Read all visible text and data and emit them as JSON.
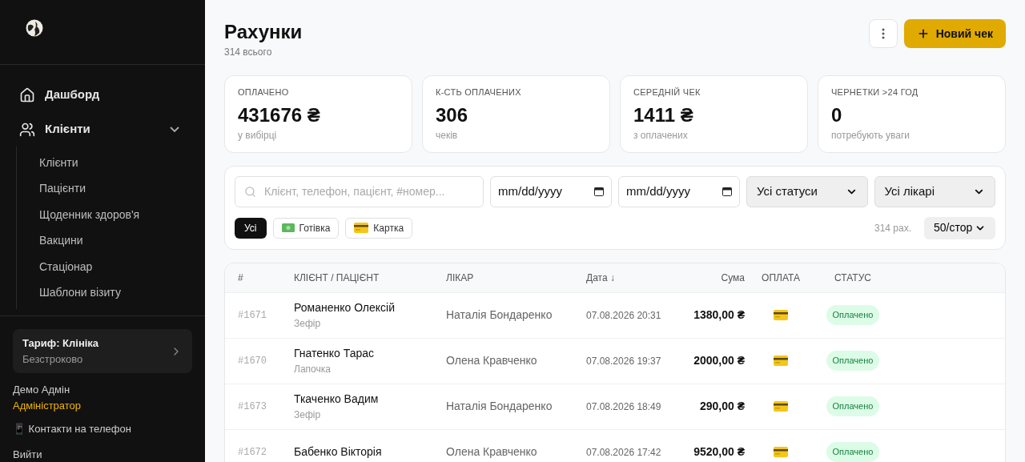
{
  "sidebar": {
    "nav": [
      {
        "label": "Дашборд"
      },
      {
        "label": "Клієнти",
        "expanded": true,
        "children": [
          {
            "label": "Клієнти"
          },
          {
            "label": "Пацієнти"
          },
          {
            "label": "Щоденник здоров'я"
          },
          {
            "label": "Вакцини"
          },
          {
            "label": "Стаціонар"
          },
          {
            "label": "Шаблони візиту"
          }
        ]
      }
    ],
    "plan": {
      "title": "Тариф: Клініка",
      "subtitle": "Безстроково"
    },
    "user": {
      "name": "Демо Адмін",
      "role": "Адміністратор"
    },
    "contacts": "📱 Контакти на телефон",
    "logout": "Вийти"
  },
  "header": {
    "title": "Рахунки",
    "subtitle": "314 всього",
    "new_button": "Новий чек"
  },
  "stats": [
    {
      "label": "ОПЛАЧЕНО",
      "value": "431676 ₴",
      "note": "у вибірці"
    },
    {
      "label": "К-СТЬ ОПЛАЧЕНИХ",
      "value": "306",
      "note": "чеків"
    },
    {
      "label": "СЕРЕДНІЙ ЧЕК",
      "value": "1411 ₴",
      "note": "з оплачених"
    },
    {
      "label": "ЧЕРНЕТКИ >24 ГОД",
      "value": "0",
      "note": "потребують уваги"
    }
  ],
  "filters": {
    "search": {
      "placeholder": "Клієнт, телефон, пацієнт, #номер..."
    },
    "date_from": "mm/dd/yyyy",
    "date_to": "mm/dd/yyyy",
    "status": "Усі статуси",
    "doctor": "Усі лікарі",
    "chips": [
      {
        "label": "Усі",
        "kind": "all",
        "selected": true
      },
      {
        "label": "Готівка",
        "kind": "cash",
        "selected": false
      },
      {
        "label": "Картка",
        "kind": "card",
        "selected": false
      }
    ],
    "count": "314 рах.",
    "per_page": "50/стор"
  },
  "table": {
    "columns": [
      "#",
      "КЛІЄНТ / ПАЦІЄНТ",
      "ЛІКАР",
      "Дата ↓",
      "Сума",
      "ОПЛАТА",
      "СТАТУС"
    ],
    "rows": [
      {
        "number": "#1671",
        "client": "Романенко Олексій",
        "patient": "Зефір",
        "doctor": "Наталія Бондаренко",
        "date": "07.08.2026 20:31",
        "sum": "1380,00 ₴",
        "kind": "card",
        "status": "Оплачено"
      },
      {
        "number": "#1670",
        "client": "Гнатенко Тарас",
        "patient": "Лапочка",
        "doctor": "Олена Кравченко",
        "date": "07.08.2026 19:37",
        "sum": "2000,00 ₴",
        "kind": "card",
        "status": "Оплачено"
      },
      {
        "number": "#1673",
        "client": "Ткаченко Вадим",
        "patient": "Зефір",
        "doctor": "Наталія Бондаренко",
        "date": "07.08.2026 18:49",
        "sum": "290,00 ₴",
        "kind": "card",
        "status": "Оплачено"
      },
      {
        "number": "#1672",
        "client": "Бабенко Вікторія",
        "doctor": "Олена Кравченко",
        "date": "07.08.2026 17:42",
        "sum": "9520,00 ₴",
        "kind": "card",
        "status": "Оплачено"
      }
    ]
  }
}
